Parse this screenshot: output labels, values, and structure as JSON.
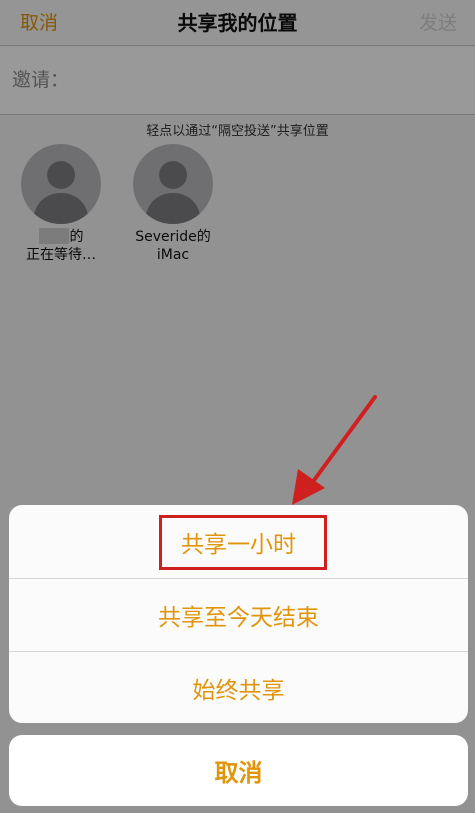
{
  "navbar": {
    "cancel_label": "取消",
    "title": "共享我的位置",
    "send_label": "发送"
  },
  "invite": {
    "label": "邀请："
  },
  "airdrop": {
    "hint": "轻点以通过“隔空投送”共享位置",
    "contacts": [
      {
        "name": "的",
        "status": "正在等待…"
      },
      {
        "name": "Severide的",
        "status": "iMac"
      }
    ]
  },
  "action_sheet": {
    "options": [
      {
        "label": "共享一小时"
      },
      {
        "label": "共享至今天结束"
      },
      {
        "label": "始终共享"
      }
    ],
    "cancel_label": "取消"
  },
  "colors": {
    "accent": "#e0950a",
    "annotation": "#d01f1f"
  },
  "icons": [
    "person-silhouette-icon",
    "annotation-arrow-icon"
  ]
}
